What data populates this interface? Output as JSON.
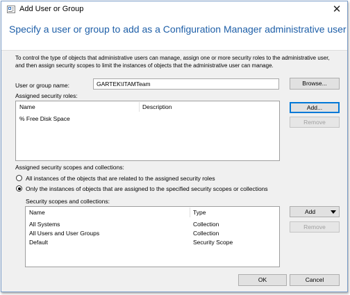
{
  "window": {
    "title": "Add User or Group",
    "close_glyph": "✕"
  },
  "header": {
    "title": "Specify a user or group to add as a Configuration Manager administrative user"
  },
  "description": "To control the type of objects that administrative users can manage, assign one or more security roles  to the  administrative user, and then assign security scopes to limit the instances of objects that the administrative user can manage.",
  "user_group": {
    "label": "User or group name:",
    "value": "GARTEK\\ITAMTeam",
    "browse_label": "Browse..."
  },
  "roles": {
    "label": "Assigned security roles:",
    "columns": [
      "Name",
      "Description"
    ],
    "rows": [
      {
        "name": "% Free Disk Space",
        "description": ""
      }
    ],
    "add_label": "Add...",
    "remove_label": "Remove"
  },
  "scopes": {
    "label": "Assigned security scopes and collections:",
    "option_all": "All instances of the objects that are related to the assigned security roles",
    "option_specified": "Only the instances of objects that are assigned to the specified security scopes or collections",
    "selected": "specified",
    "list_label": "Security scopes and collections:",
    "columns": [
      "Name",
      "Type"
    ],
    "rows": [
      {
        "name": "All Systems",
        "type": "Collection"
      },
      {
        "name": "All Users and User Groups",
        "type": "Collection"
      },
      {
        "name": "Default",
        "type": "Security Scope"
      }
    ],
    "add_label": "Add",
    "remove_label": "Remove"
  },
  "footer": {
    "ok_label": "OK",
    "cancel_label": "Cancel"
  },
  "colors": {
    "accent": "#1e5fa8",
    "focus_border": "#0078d7"
  },
  "icons": {
    "app": "window-icon",
    "close": "close-icon",
    "dropdown": "chevron-down-icon"
  }
}
